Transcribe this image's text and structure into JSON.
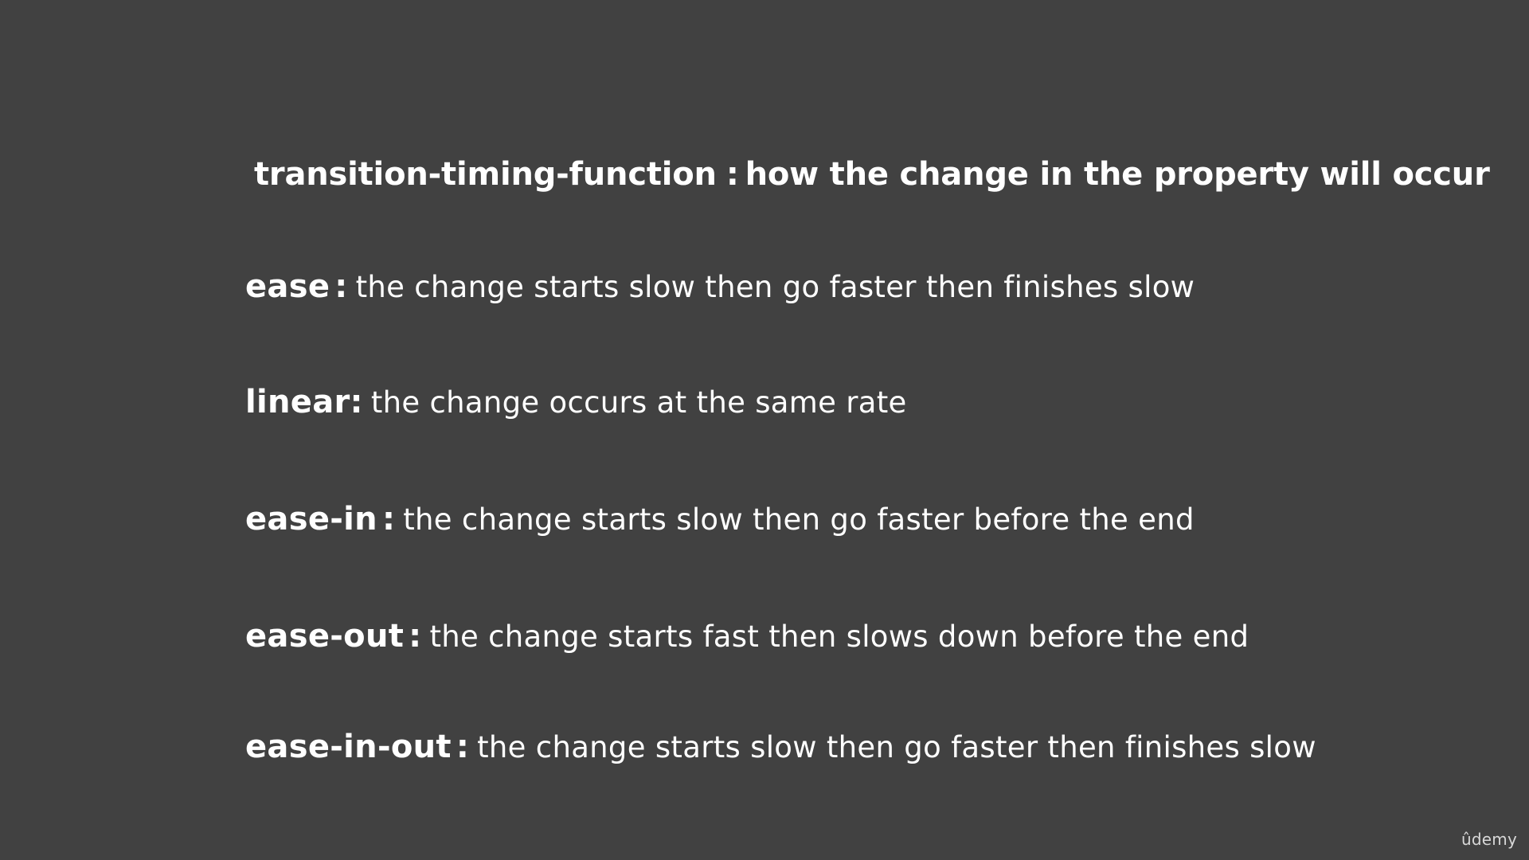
{
  "heading": {
    "property": "transition-timing-function",
    "separator": ":",
    "description": "how the change in the property will occur"
  },
  "items": [
    {
      "term": "ease",
      "separator": ":",
      "description": "the change starts slow then go faster then finishes slow"
    },
    {
      "term": "linear",
      "separator": ":",
      "description": "the change occurs at the same rate"
    },
    {
      "term": "ease-in",
      "separator": ":",
      "description": "the change starts slow then go faster before the end"
    },
    {
      "term": "ease-out",
      "separator": ":",
      "description": "the change starts fast then slows down before the end"
    },
    {
      "term": "ease-in-out",
      "separator": ":",
      "description": "the change starts slow then go faster then finishes slow"
    }
  ],
  "watermark": "ûdemy",
  "colors": {
    "background": "#414141",
    "text": "#ffffff",
    "watermark": "#d8d8d8"
  }
}
